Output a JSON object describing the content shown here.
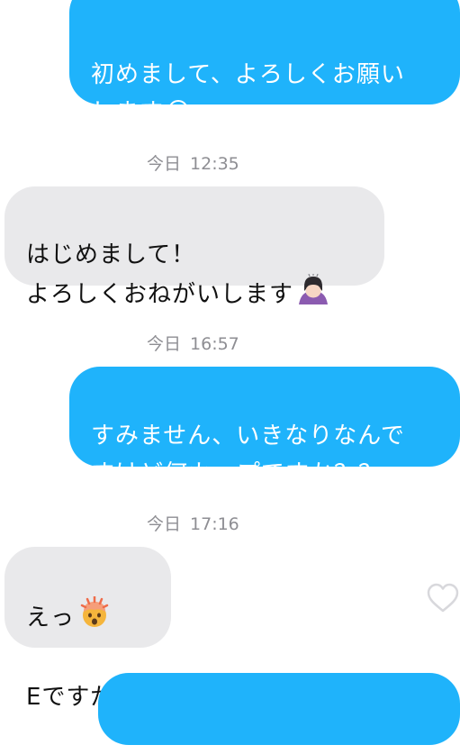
{
  "messages": [
    {
      "direction": "outgoing",
      "text": "初めまして、よろしくお願い\nします",
      "emoji": "smiling-face-icon"
    },
    {
      "direction": "incoming",
      "text": "はじめまして！\nよろしくおねがいします",
      "emoji": "person-bowing-icon"
    },
    {
      "direction": "outgoing",
      "text": "すみません、いきなりなんで\nすけど何カップですか？？"
    },
    {
      "direction": "incoming",
      "text_line1": "えっ",
      "text_line2": "Eですが。",
      "emoji": "exploding-head-icon"
    }
  ],
  "timestamps": [
    {
      "day": "今日",
      "time": "12:35"
    },
    {
      "day": "今日",
      "time": "16:57"
    },
    {
      "day": "今日",
      "time": "17:16"
    }
  ],
  "colors": {
    "outgoing_bubble": "#1fb3fb",
    "incoming_bubble": "#e9e9eb",
    "timestamp": "#8e8e93",
    "heart_outline": "#d8d8dc"
  },
  "icons": {
    "like": "heart-icon"
  }
}
